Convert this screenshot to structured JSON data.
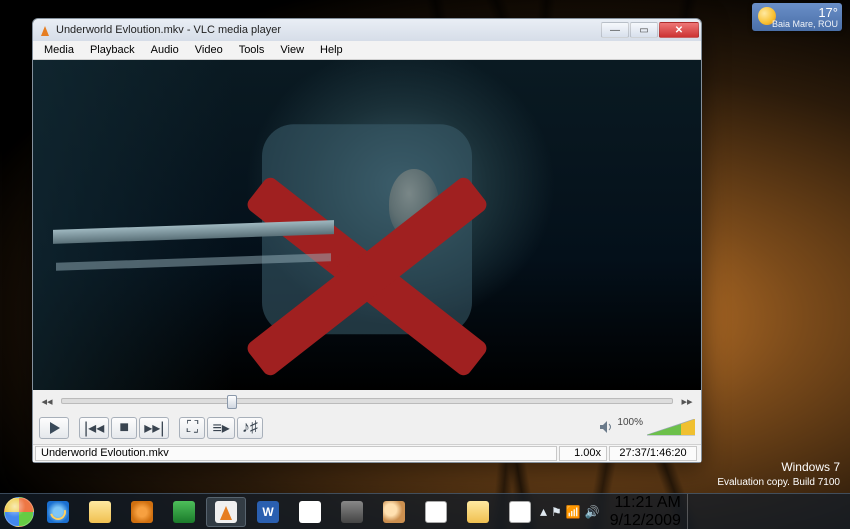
{
  "weather": {
    "temperature": "17°",
    "location": "Baia Mare, ROU"
  },
  "window": {
    "title": "Underworld Evloution.mkv - VLC media player",
    "menu": {
      "media": "Media",
      "playback": "Playback",
      "audio": "Audio",
      "video": "Video",
      "tools": "Tools",
      "view": "View",
      "help": "Help"
    },
    "volume_pct": "100%",
    "status": {
      "filename": "Underworld Evloution.mkv",
      "speed": "1.00x",
      "time": "27:37/1:46:20"
    }
  },
  "branding": {
    "os": "Windows 7",
    "note": "Evaluation copy. Build 7100"
  },
  "clock": {
    "time": "11:21 AM",
    "date": "9/12/2009"
  },
  "taskbar_word_glyph": "W"
}
